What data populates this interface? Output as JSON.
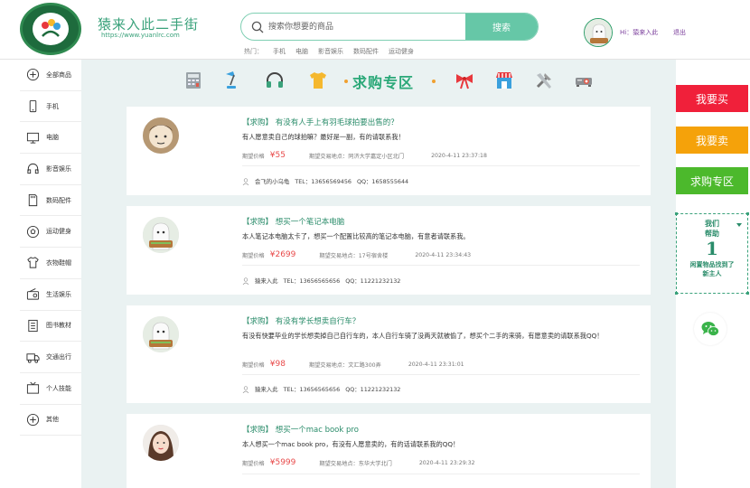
{
  "header": {
    "site_name": "猿来入此二手街",
    "site_url": "https://www.yuanlrc.com",
    "search_placeholder": "搜索你想要的商品",
    "search_button": "搜索",
    "hot_label": "热门：",
    "hot_items": [
      "手机",
      "电脑",
      "影音娱乐",
      "数码配件",
      "运动健身"
    ],
    "user_greeting": "Hi：猿来入此",
    "logout": "退出"
  },
  "sidebar": {
    "items": [
      {
        "label": "全部商品",
        "icon": "plus-circle-icon"
      },
      {
        "label": "手机",
        "icon": "phone-icon"
      },
      {
        "label": "电脑",
        "icon": "monitor-icon"
      },
      {
        "label": "影音娱乐",
        "icon": "headphones-icon"
      },
      {
        "label": "数码配件",
        "icon": "sd-card-icon"
      },
      {
        "label": "运动健身",
        "icon": "football-icon"
      },
      {
        "label": "衣物鞋帽",
        "icon": "shirt-icon"
      },
      {
        "label": "生活娱乐",
        "icon": "radio-icon"
      },
      {
        "label": "图书教材",
        "icon": "book-icon"
      },
      {
        "label": "交通出行",
        "icon": "truck-icon"
      },
      {
        "label": "个人技能",
        "icon": "tv-icon"
      },
      {
        "label": "其他",
        "icon": "plus-circle-icon"
      }
    ]
  },
  "banner": {
    "title": "求购专区"
  },
  "posts": [
    {
      "title": "【求购】 有没有人手上有羽毛球拍要出售的？",
      "desc": "有人愿意卖自己的球拍嘛？最好是一副，有的请联系我！",
      "price_label": "期望价格",
      "price": "¥55",
      "loc_label": "期望交易地点：",
      "loc": "同济大学嘉定小区北门",
      "time": "2020-4-11 23:37:18",
      "user": "会飞的小乌龟",
      "tel": "TEL：13656569456",
      "qq": "QQ：1658555644"
    },
    {
      "title": "【求购】 想买一个笔记本电脑",
      "desc": "本人笔记本电脑太卡了，想买一个配置比较高的笔记本电脑，有意者请联系我。",
      "price_label": "期望价格",
      "price": "¥2699",
      "loc_label": "期望交易地点：",
      "loc": "17号宿舍楼",
      "time": "2020-4-11 23:34:43",
      "user": "猿来入此",
      "tel": "TEL：13656565656",
      "qq": "QQ：11221232132"
    },
    {
      "title": "【求购】 有没有学长想卖自行车？",
      "desc": "有没有快要毕业的学长想卖掉自己自行车的，本人自行车骑了没两天就被偷了，想买个二手的来骑，有愿意卖的请联系我QQ！",
      "price_label": "期望价格",
      "price": "¥98",
      "loc_label": "期望交易地点：",
      "loc": "文汇路300弄",
      "time": "2020-4-11 23:31:01",
      "user": "猿来入此",
      "tel": "TEL：13656565656",
      "qq": "QQ：11221232132"
    },
    {
      "title": "【求购】 想买一个mac book pro",
      "desc": "本人想买一个mac book pro，有没有人愿意卖的，有的话请联系我的QQ！",
      "price_label": "期望价格",
      "price": "¥5999",
      "loc_label": "期望交易地点：",
      "loc": "东华大学北门",
      "time": "2020-4-11 23:29:32"
    }
  ],
  "right_panel": {
    "buy": "我要买",
    "sell": "我要卖",
    "wanted": "求购专区",
    "help_line1": "我们",
    "help_line2": "帮助",
    "help_count": "1",
    "help_line3": "闲置物品找到了",
    "help_line4": "新主人"
  },
  "colors": {
    "accent": "#66c7a7",
    "buy": "#f0203a",
    "sell": "#f5a20a",
    "wanted": "#4cb92c",
    "price": "#e84a4a"
  }
}
